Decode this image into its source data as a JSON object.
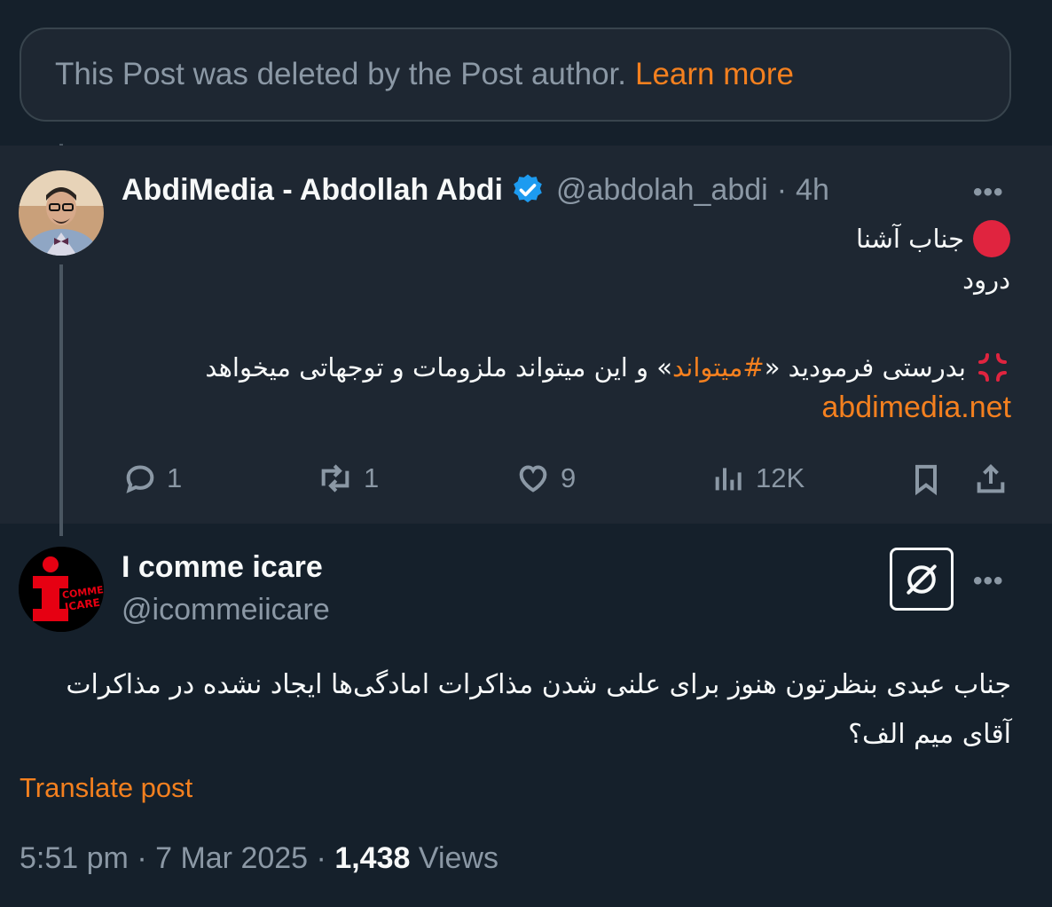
{
  "deleted_notice": {
    "text": "This Post was deleted by the Post author.",
    "link": "Learn more"
  },
  "reply_post": {
    "display_name": "AbdiMedia - Abdollah Abdi",
    "handle": "@abdolah_abdi",
    "separator": "·",
    "time": "4h",
    "verified": true,
    "more": "•••",
    "lines": {
      "line1": "جناب آشنا",
      "line2": "درود",
      "line3_pre": "بدرستی فرمودید «",
      "hashtag": "#میتواند",
      "line3_post": "» و این میتواند ملزومات و توجهاتی میخواهد",
      "link": "abdimedia.net"
    },
    "actions": {
      "replies": "1",
      "reposts": "1",
      "likes": "9",
      "views": "12K"
    }
  },
  "main_post": {
    "display_name": "I comme icare",
    "handle": "@icommeiicare",
    "more": "•••",
    "avatar_text": "COMME ICARE",
    "text_line1": "جناب عبدی بنظرتون هنوز برای علنی شدن مذاکرات امادگی‌ها ایجاد نشده در مذاکرات",
    "text_line2": "آقای میم الف؟",
    "translate": "Translate post",
    "time": "5:51 pm",
    "dot": "·",
    "date": "7 Mar 2025",
    "views_count": "1,438",
    "views_label": "Views"
  },
  "colors": {
    "background": "#15202b",
    "accent": "#f4801f",
    "muted": "#8b98a5",
    "verified": "#1d9bf0"
  }
}
